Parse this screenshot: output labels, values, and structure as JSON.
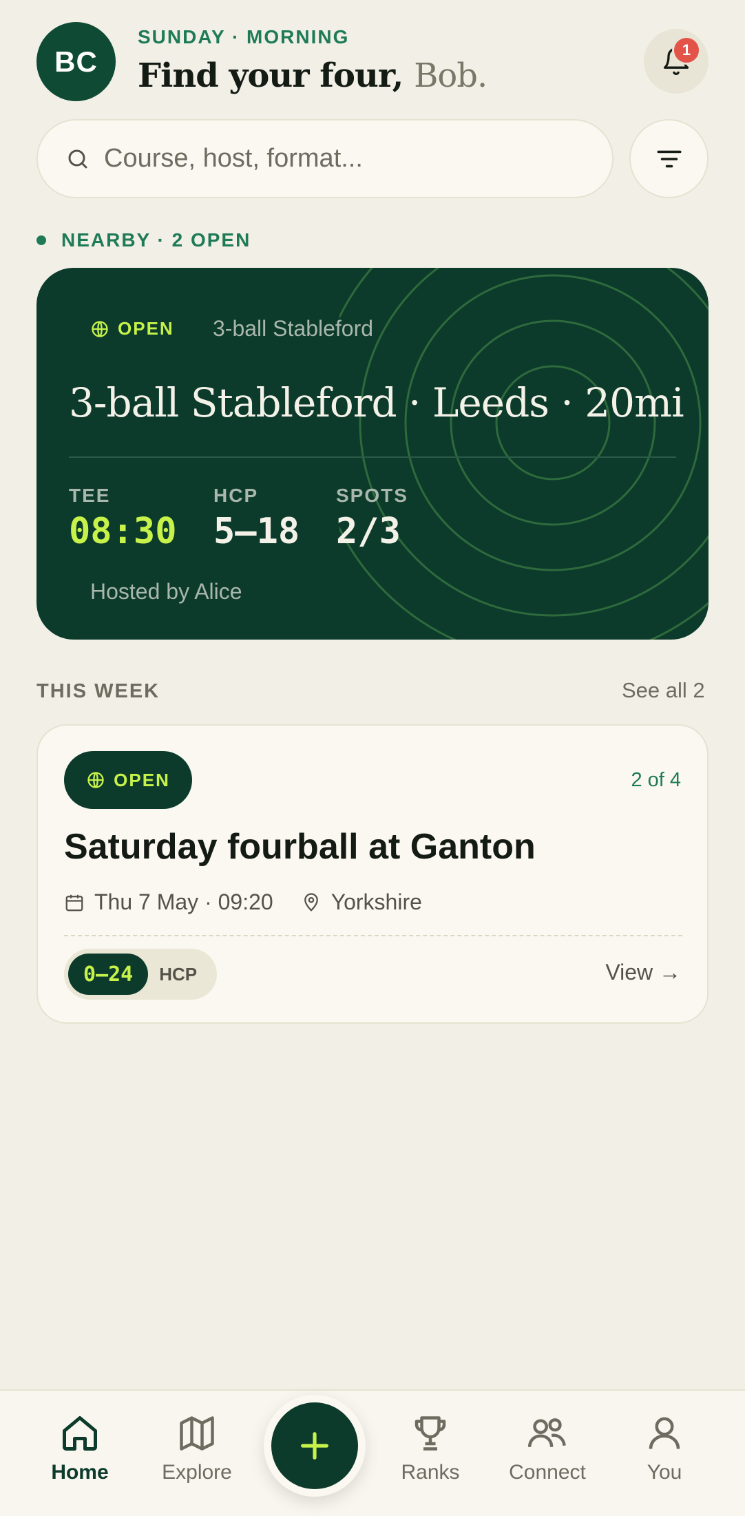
{
  "header": {
    "avatar_initials": "BC",
    "eyebrow": "SUNDAY · MORNING",
    "greeting": "Find your four,",
    "name": "Bob.",
    "notification_count": "1"
  },
  "search": {
    "placeholder": "Course, host, format..."
  },
  "nearby": {
    "label": "NEARBY · 2 OPEN"
  },
  "featured": {
    "status": "OPEN",
    "format": "3-ball Stableford",
    "title": "3-ball Stableford · Leeds · 20mi",
    "stats": [
      {
        "label": "TEE",
        "value": "08:30"
      },
      {
        "label": "HCP",
        "value": "5–18"
      },
      {
        "label": "SPOTS",
        "value": "2/3"
      }
    ],
    "host": "Hosted by Alice"
  },
  "this_week": {
    "label": "THIS WEEK",
    "see_all": "See all 2",
    "event": {
      "status": "OPEN",
      "count": "2 of 4",
      "title": "Saturday fourball at Ganton",
      "date": "Thu 7 May · 09:20",
      "location": "Yorkshire",
      "hcp_range": "0–24",
      "hcp_unit": "HCP",
      "view_label": "View →"
    }
  },
  "nav": {
    "items": [
      {
        "label": "Home",
        "icon": "home-icon"
      },
      {
        "label": "Explore",
        "icon": "map-icon"
      },
      {
        "label": "Ranks",
        "icon": "trophy-icon"
      },
      {
        "label": "Connect",
        "icon": "users-icon"
      },
      {
        "label": "You",
        "icon": "user-icon"
      }
    ]
  },
  "colors": {
    "brand_dark": "#0c3b2c",
    "accent_lime": "#c6f24a",
    "brand_green": "#1f7a57",
    "badge_red": "#e2534a",
    "background": "#f2f0e6"
  }
}
